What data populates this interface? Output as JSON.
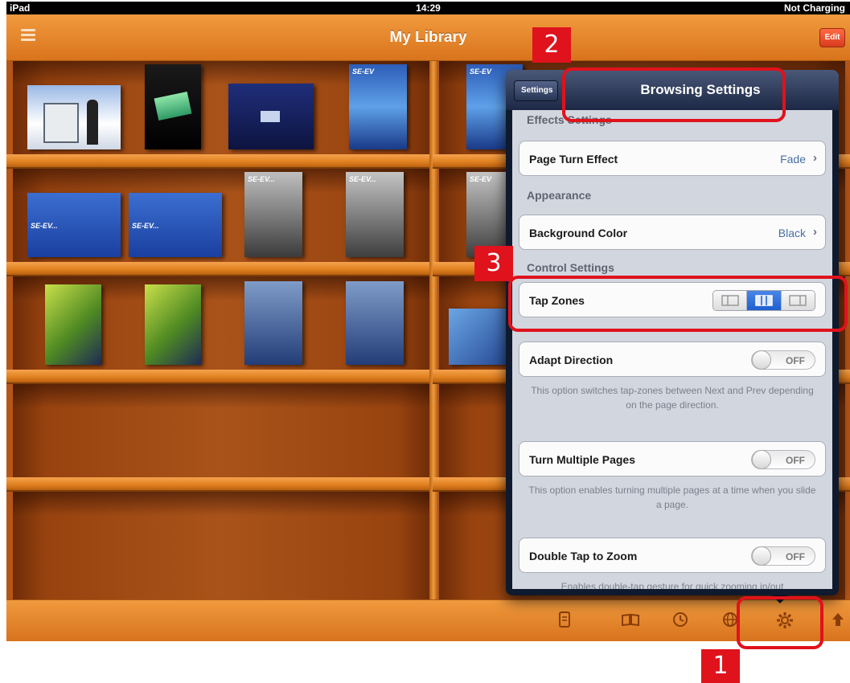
{
  "status_bar": {
    "device": "iPad",
    "time": "14:29",
    "battery": "Not Charging"
  },
  "nav": {
    "title": "My Library",
    "edit_label": "Edit",
    "menu_icon": "hamburger-icon"
  },
  "books": {
    "row1": [
      "",
      "",
      "",
      "SE-EV"
    ],
    "row2": [
      "SE-EV...",
      "SE-EV...",
      "SE-EV...",
      "SE-EV..."
    ],
    "row3": [
      "",
      "",
      "",
      ""
    ],
    "right_row1": [
      "SE-EV"
    ],
    "right_row2": [
      "SE-EV"
    ]
  },
  "popover": {
    "back_label": "Settings",
    "title": "Browsing Settings",
    "sections": {
      "effects": "Effects Settings",
      "appearance": "Appearance",
      "control": "Control Settings"
    },
    "page_turn": {
      "label": "Page Turn Effect",
      "value": "Fade"
    },
    "background": {
      "label": "Background Color",
      "value": "Black"
    },
    "tap_zones": {
      "label": "Tap Zones",
      "selected_index": 1
    },
    "adapt_direction": {
      "label": "Adapt Direction",
      "state": "OFF",
      "note": "This option switches tap-zones between Next and Prev depending on the page direction."
    },
    "turn_multiple": {
      "label": "Turn Multiple Pages",
      "state": "OFF",
      "note": "This option enables turning multiple pages at a time when you slide a page."
    },
    "double_tap": {
      "label": "Double Tap to Zoom",
      "state": "OFF",
      "note": "Enables double-tap gesture for quick zooming in/out"
    }
  },
  "toolbar": {
    "icons": [
      "document-icon",
      "book-open-icon",
      "clock-icon",
      "globe-icon",
      "gear-icon",
      "upload-icon"
    ]
  },
  "annotations": {
    "badge1": "1",
    "badge2": "2",
    "badge3": "3"
  },
  "colors": {
    "accent_red": "#e0121c",
    "shelf_orange": "#e8852a",
    "popover_navy": "#0f1a2e",
    "toggle_blue": "#1d5fcf"
  }
}
